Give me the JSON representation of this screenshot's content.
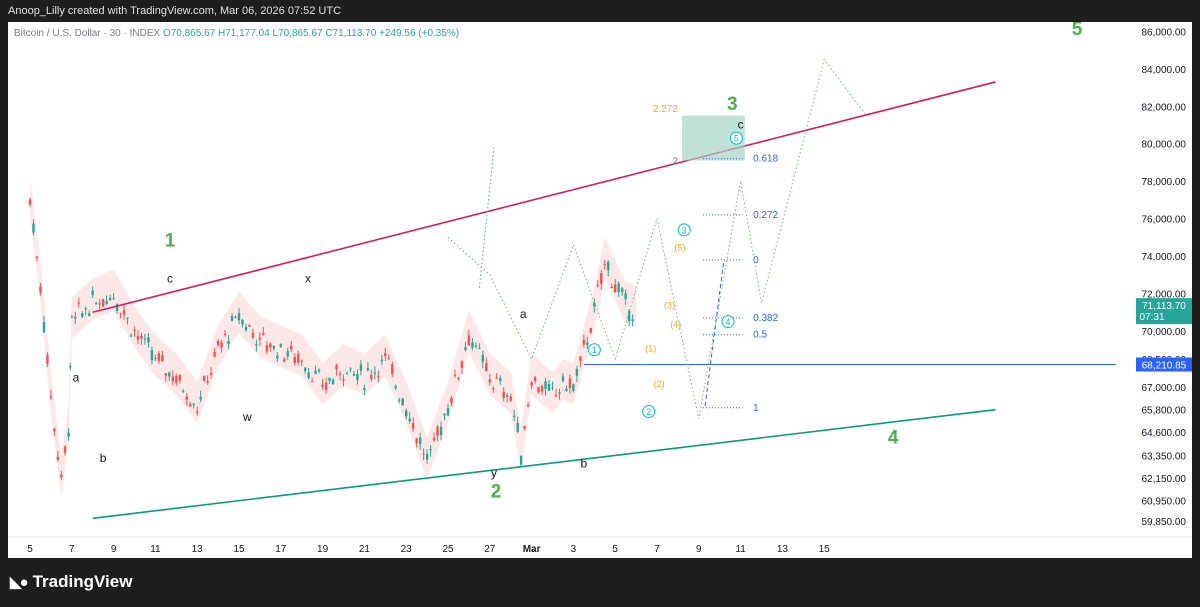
{
  "header": {
    "caption": "Anoop_Lilly created with TradingView.com, Mar 06, 2026 07:52 UTC"
  },
  "legend": {
    "symbol": "Bitcoin / U.S. Dollar · 30 · INDEX",
    "open": "O70,865.67",
    "high": "H71,177.04",
    "low": "L70,865.67",
    "close": "C71,113.70",
    "change": "+249.56 (+0.35%)"
  },
  "brand": {
    "logo_icon": "tradingview-logo-icon",
    "name": "TradingView"
  },
  "colors": {
    "up": "#26a69a",
    "down": "#ef5350",
    "channel_top": "#d81b60",
    "channel_bottom": "#089981",
    "wave_green": "#4caf50",
    "fib_blue": "#2962ff",
    "cyan": "#00bcd4",
    "orange": "#f5a623"
  },
  "chart_data": {
    "type": "line",
    "title": "Bitcoin / U.S. Dollar · 30 · INDEX",
    "ylim": [
      59000,
      86500
    ],
    "y_ticks": [
      "86,000.00",
      "84,000.00",
      "82,000.00",
      "80,000.00",
      "78,000.00",
      "76,000.00",
      "74,000.00",
      "72,000.00",
      "70,000.00",
      "68,500.00",
      "67,000.00",
      "65,800.00",
      "64,600.00",
      "63,350.00",
      "62,150.00",
      "60,950.00",
      "59,850.00"
    ],
    "x_ticks": [
      "5",
      "7",
      "9",
      "11",
      "13",
      "15",
      "17",
      "19",
      "21",
      "23",
      "25",
      "27",
      "Mar",
      "3",
      "5",
      "7",
      "9",
      "11",
      "13",
      "15"
    ],
    "price_labels": {
      "last": "71,113.70",
      "countdown": "07:31",
      "level": "68,210.85"
    },
    "series": [
      {
        "x": [
          "Feb 5",
          "Feb 5",
          "Feb 6",
          "Feb 6",
          "Feb 6",
          "Feb 7",
          "Feb 8",
          "Feb 9",
          "Feb 9",
          "Feb 10",
          "Feb 11",
          "Feb 12",
          "Feb 13",
          "Feb 14",
          "Feb 15",
          "Feb 16",
          "Feb 17",
          "Feb 18",
          "Feb 19",
          "Feb 20",
          "Feb 21",
          "Feb 22",
          "Feb 23",
          "Feb 24",
          "Feb 24",
          "Feb 25",
          "Feb 26",
          "Feb 27",
          "Feb 28",
          "Feb 28",
          "Mar 1",
          "Mar 2",
          "Mar 2",
          "Mar 3",
          "Mar 4",
          "Mar 4",
          "Mar 5",
          "Mar 5",
          "Mar 6"
        ],
        "values": [
          77000,
          72500,
          66500,
          62000,
          65000,
          70500,
          71500,
          72000,
          71000,
          70000,
          68500,
          67500,
          66000,
          69000,
          70800,
          69500,
          69000,
          68500,
          67000,
          68000,
          67500,
          68500,
          66000,
          63000,
          64500,
          66000,
          69800,
          67500,
          66500,
          63500,
          67500,
          66500,
          67200,
          67000,
          71000,
          73700,
          72500,
          71300,
          71100
        ]
      }
    ],
    "annotations": {
      "waves_major": [
        "1",
        "2",
        "3",
        "4",
        "5"
      ],
      "waves_minor": [
        "a",
        "b",
        "c",
        "w",
        "x",
        "y",
        "a",
        "b",
        "c"
      ],
      "waves_circled": [
        "1",
        "2",
        "3",
        "4",
        "5"
      ],
      "waves_paren": [
        "(1)",
        "(2)",
        "(3)",
        "(4)",
        "(5)"
      ],
      "fib": [
        "2.272",
        "2",
        "0.618",
        "0.272",
        "0",
        "0.382",
        "0.5",
        "1"
      ],
      "projection_path": [
        [
          20,
          75000
        ],
        [
          22,
          73000
        ],
        [
          24,
          68500
        ],
        [
          26,
          74600
        ],
        [
          28,
          68500
        ],
        [
          30,
          76000
        ],
        [
          32,
          65300
        ],
        [
          34,
          78000
        ],
        [
          35,
          71500
        ],
        [
          38,
          84500
        ],
        [
          40,
          81500
        ]
      ]
    }
  }
}
